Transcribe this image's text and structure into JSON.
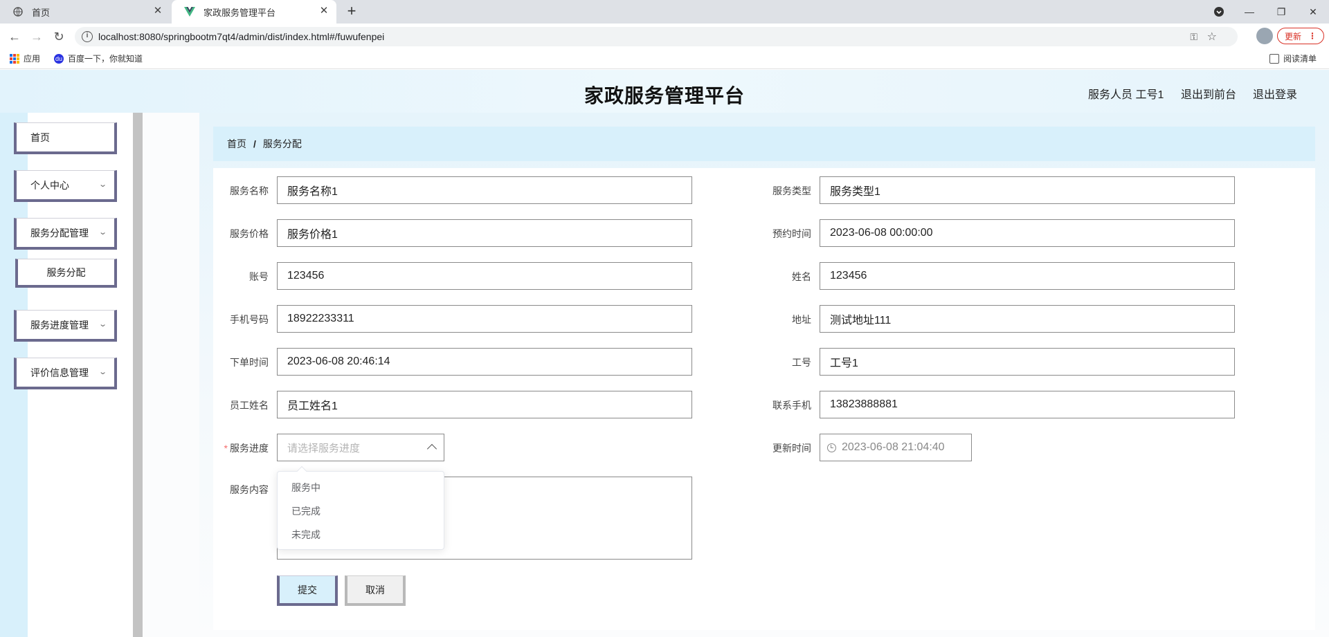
{
  "browser": {
    "tabs": [
      {
        "title": "首页",
        "active": false
      },
      {
        "title": "家政服务管理平台",
        "active": true
      }
    ],
    "url": "localhost:8080/springbootm7qt4/admin/dist/index.html#/fuwufenpei",
    "update_label": "更新",
    "bookmarks": [
      {
        "label": "应用",
        "icon": "apps-grid-icon"
      },
      {
        "label": "百度一下，你就知道",
        "icon": "baidu-paw-icon"
      }
    ],
    "reading_list_label": "阅读清单"
  },
  "app": {
    "title": "家政服务管理平台",
    "header_links": {
      "user": "服务人员 工号1",
      "to_front": "退出到前台",
      "logout": "退出登录"
    }
  },
  "sidebar": {
    "items": [
      {
        "label": "首页",
        "has_submenu": false
      },
      {
        "label": "个人中心",
        "has_submenu": true
      },
      {
        "label": "服务分配管理",
        "has_submenu": true
      },
      {
        "label": "服务分配",
        "is_sub": true
      },
      {
        "label": "服务进度管理",
        "has_submenu": true
      },
      {
        "label": "评价信息管理",
        "has_submenu": true
      }
    ]
  },
  "breadcrumb": {
    "home": "首页",
    "separator": "/",
    "current": "服务分配"
  },
  "form": {
    "left": [
      {
        "label": "服务名称",
        "value": "服务名称1"
      },
      {
        "label": "服务价格",
        "value": "服务价格1"
      },
      {
        "label": "账号",
        "value": "123456"
      },
      {
        "label": "手机号码",
        "value": "18922233311"
      },
      {
        "label": "下单时间",
        "value": "2023-06-08 20:46:14"
      },
      {
        "label": "员工姓名",
        "value": "员工姓名1"
      }
    ],
    "right": [
      {
        "label": "服务类型",
        "value": "服务类型1"
      },
      {
        "label": "预约时间",
        "value": "2023-06-08 00:00:00"
      },
      {
        "label": "姓名",
        "value": "123456"
      },
      {
        "label": "地址",
        "value": "测试地址111"
      },
      {
        "label": "工号",
        "value": "工号1"
      },
      {
        "label": "联系手机",
        "value": "13823888881"
      }
    ],
    "progress": {
      "required_mark": "*",
      "label": "服务进度",
      "placeholder": "请选择服务进度",
      "options": [
        "服务中",
        "已完成",
        "未完成"
      ]
    },
    "update_time": {
      "label": "更新时间",
      "value": "2023-06-08 21:04:40"
    },
    "content": {
      "label": "服务内容",
      "value": ""
    },
    "submit_label": "提交",
    "cancel_label": "取消"
  },
  "colors": {
    "accent_border": "#6b6a8e",
    "header_bg": "#e2f3fc",
    "breadcrumb_bg": "#d8f0fb"
  }
}
